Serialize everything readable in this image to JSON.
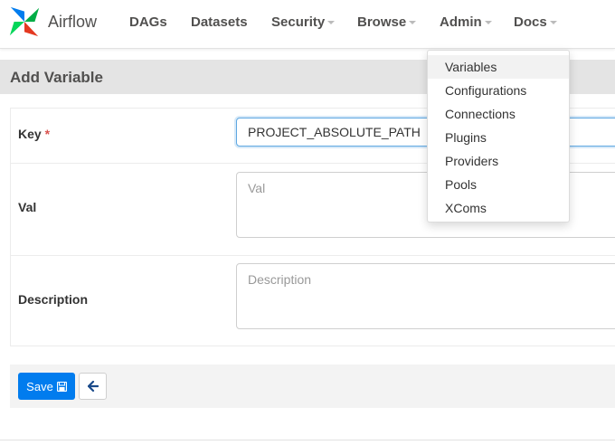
{
  "brand": {
    "name": "Airflow"
  },
  "nav": {
    "dags": "DAGs",
    "datasets": "Datasets",
    "security": "Security",
    "browse": "Browse",
    "admin": "Admin",
    "docs": "Docs"
  },
  "page": {
    "title": "Add Variable"
  },
  "form": {
    "key_label": "Key",
    "required_mark": "*",
    "key_value": "PROJECT_ABSOLUTE_PATH",
    "val_label": "Val",
    "val_placeholder": "Val",
    "description_label": "Description",
    "description_placeholder": "Description"
  },
  "actions": {
    "save_label": "Save",
    "save_icon": "floppy-disk-icon",
    "back_icon": "arrow-left-icon"
  },
  "admin_menu": {
    "items": [
      "Variables",
      "Configurations",
      "Connections",
      "Plugins",
      "Providers",
      "Pools",
      "XComs"
    ],
    "active": "Variables"
  },
  "colors": {
    "primary": "#017cee",
    "required": "#d9534f",
    "header_bg": "#e4e4e4"
  }
}
